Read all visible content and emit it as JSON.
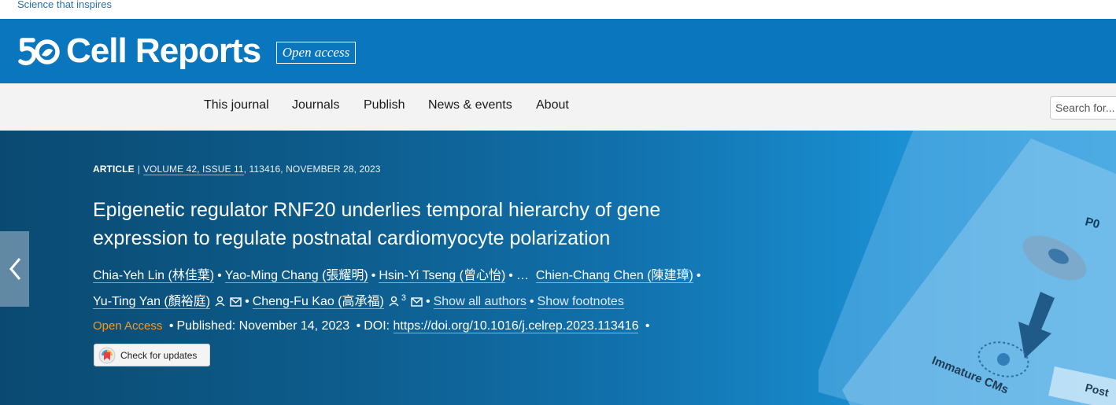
{
  "top": {
    "tagline": "Science that inspires"
  },
  "brand": {
    "logo_text": "Cell Reports",
    "badge": "Open access"
  },
  "nav": {
    "items": [
      "This journal",
      "Journals",
      "Publish",
      "News & events",
      "About"
    ],
    "search_placeholder": "Search for..."
  },
  "article": {
    "type": "ARTICLE",
    "separator": "|",
    "volume": "VOLUME 42, ISSUE 11",
    "rest": ", 113416, NOVEMBER 28, 2023",
    "title": "Epigenetic regulator RNF20 underlies temporal hierarchy of gene expression to regulate postnatal cardiomyocyte polarization",
    "authors": [
      "Chia-Yeh Lin (林佳葉)",
      "Yao-Ming Chang (張耀明)",
      "Hsin-Yi Tseng (曾心怡)",
      "Chien-Chang Chen (陳建璋)",
      "Yu-Ting Yan (顏裕庭)",
      "Cheng-Fu Kao (高承福)"
    ],
    "ellipsis": "…",
    "kao_sup": "3",
    "show_all_authors": "Show all authors",
    "show_footnotes": "Show footnotes",
    "open_access": "Open Access",
    "published": "Published: November 14, 2023",
    "doi_label": "DOI:",
    "doi": "https://doi.org/10.1016/j.celrep.2023.113416",
    "check_updates": "Check for updates",
    "figure_labels": {
      "p0": "P0",
      "immature": "Immature CMs",
      "post": "Post"
    }
  },
  "colors": {
    "brand_blue": "#0a76be",
    "nav_bg": "#f3f3f3",
    "open_access_orange": "#f39a24"
  }
}
